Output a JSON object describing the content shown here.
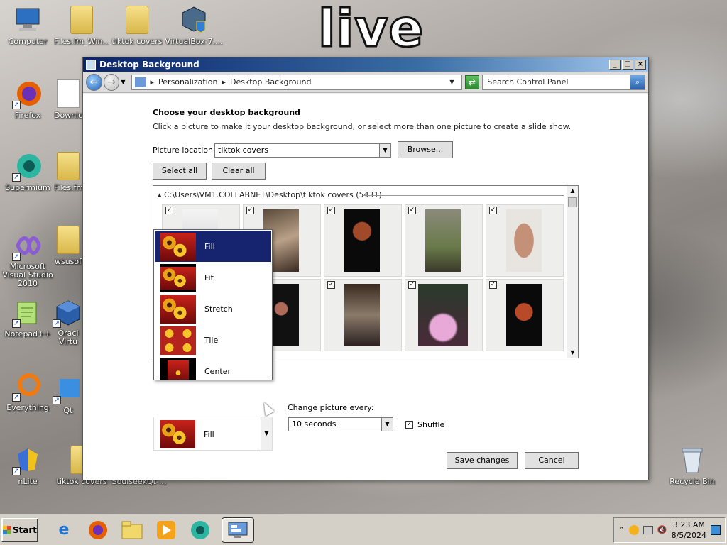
{
  "overlay_text": "live",
  "desktop_icons": [
    {
      "label": "Computer",
      "icon": "computer-icon"
    },
    {
      "label": "Files.fm_Win...",
      "icon": "folder-icon"
    },
    {
      "label": "tiktok covers",
      "icon": "folder-icon"
    },
    {
      "label": "VirtualBox-7....",
      "icon": "installer-icon"
    },
    {
      "label": "Firefox",
      "icon": "firefox-icon"
    },
    {
      "label": "Downlo",
      "icon": "file-icon"
    },
    {
      "label": "Supermium",
      "icon": "supermium-icon"
    },
    {
      "label": "Files.fm",
      "icon": "folder-icon"
    },
    {
      "label": "Microsoft Visual Studio 2010",
      "icon": "visual-studio-icon"
    },
    {
      "label": "wsusof",
      "icon": "folder-icon"
    },
    {
      "label": "Notepad++",
      "icon": "notepad-plus-plus-icon"
    },
    {
      "label": "Oracl Virtu",
      "icon": "virtualbox-icon"
    },
    {
      "label": "Everything",
      "icon": "everything-icon"
    },
    {
      "label": "Qt",
      "icon": "qt-icon"
    },
    {
      "label": "nLite",
      "icon": "nlite-icon"
    },
    {
      "label": "tiktok covers",
      "icon": "folder-icon"
    },
    {
      "label": "SoulseekQt-...",
      "icon": "soulseek-icon"
    },
    {
      "label": "Recycle Bin",
      "icon": "recycle-bin-icon"
    }
  ],
  "window": {
    "title": "Desktop Background",
    "breadcrumb": [
      "Personalization",
      "Desktop Background"
    ],
    "search_placeholder": "Search Control Panel",
    "heading": "Choose your desktop background",
    "subheading": "Click a picture to make it your desktop background, or select more than one picture to create a slide show.",
    "picture_location_label": "Picture location:",
    "picture_location_value": "tiktok covers",
    "browse_label": "Browse...",
    "select_all_label": "Select all",
    "clear_all_label": "Clear all",
    "gallery_header": "C:\\Users\\VM1.COLLABNET\\Desktop\\tiktok covers (5431)",
    "picture_position_value": "Fill",
    "picture_position_options": [
      "Fill",
      "Fit",
      "Stretch",
      "Tile",
      "Center"
    ],
    "change_every_label": "Change picture every:",
    "change_every_value": "10 seconds",
    "shuffle_label": "Shuffle",
    "shuffle_checked": true,
    "save_label": "Save changes",
    "cancel_label": "Cancel"
  },
  "taskbar": {
    "start_label": "Start",
    "apps": [
      "internet-explorer-icon",
      "firefox-icon",
      "explorer-icon",
      "media-player-icon",
      "supermium-icon",
      "control-panel-icon"
    ],
    "time": "3:23 AM",
    "date": "8/5/2024"
  }
}
